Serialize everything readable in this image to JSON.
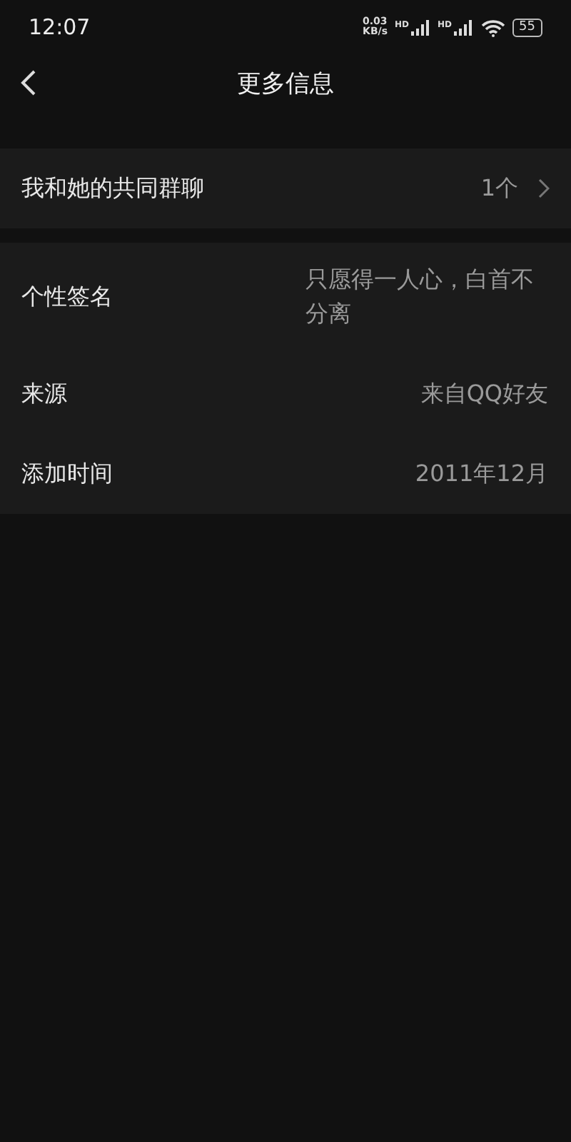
{
  "status_bar": {
    "time": "12:07",
    "net_speed": "0.03",
    "net_unit": "KB/s",
    "signal_labels": [
      "HD",
      "HD"
    ],
    "battery": "55"
  },
  "header": {
    "title": "更多信息"
  },
  "group_chats": {
    "label": "我和她的共同群聊",
    "value": "1个"
  },
  "details": [
    {
      "label": "个性签名",
      "value": "只愿得一人心，白首不分离"
    },
    {
      "label": "来源",
      "value": "来自QQ好友"
    },
    {
      "label": "添加时间",
      "value": "2011年12月"
    }
  ]
}
